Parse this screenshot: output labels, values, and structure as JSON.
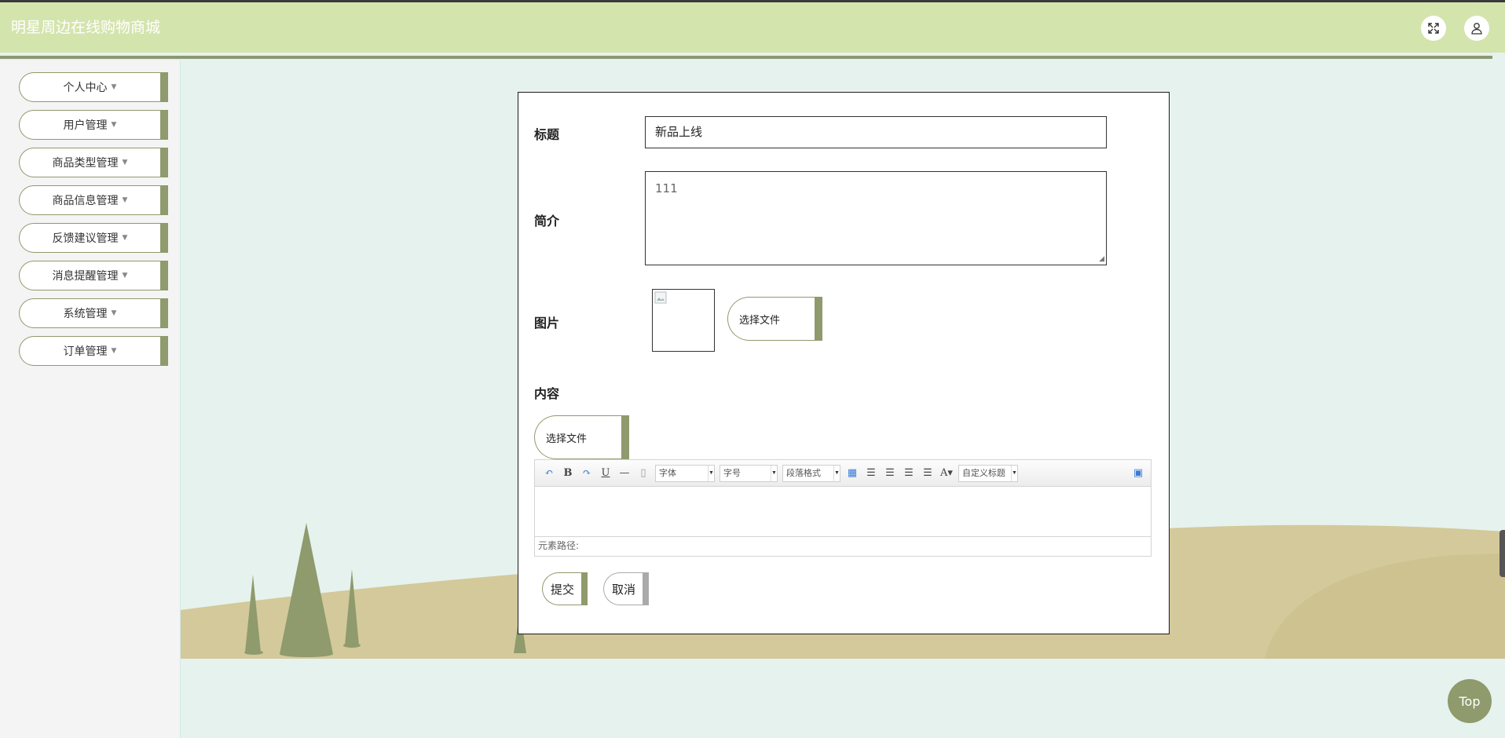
{
  "header": {
    "title": "明星周边在线购物商城",
    "fullscreen_icon": "fullscreen-icon",
    "user_icon": "user-icon"
  },
  "sidebar": {
    "items": [
      {
        "label": "个人中心"
      },
      {
        "label": "用户管理"
      },
      {
        "label": "商品类型管理"
      },
      {
        "label": "商品信息管理"
      },
      {
        "label": "反馈建议管理"
      },
      {
        "label": "消息提醒管理"
      },
      {
        "label": "系统管理"
      },
      {
        "label": "订单管理"
      }
    ]
  },
  "form": {
    "title_label": "标题",
    "title_value": "新品上线",
    "intro_label": "简介",
    "intro_value": "111",
    "image_label": "图片",
    "choose_file_image": "选择文件",
    "content_label": "内容",
    "choose_file_content": "选择文件",
    "editor": {
      "font_select": "字体",
      "size_select": "字号",
      "paragraph_select": "段落格式",
      "custom_title_select": "自定义标题",
      "path_label": "元素路径:"
    },
    "submit_label": "提交",
    "cancel_label": "取消"
  },
  "top_button": "Top",
  "colors": {
    "header_bg": "#d4e4ad",
    "accent": "#8f9a6d",
    "page_bg": "#e6f2ed",
    "hill": "#d3c99a",
    "tree": "#8f9a6d"
  }
}
